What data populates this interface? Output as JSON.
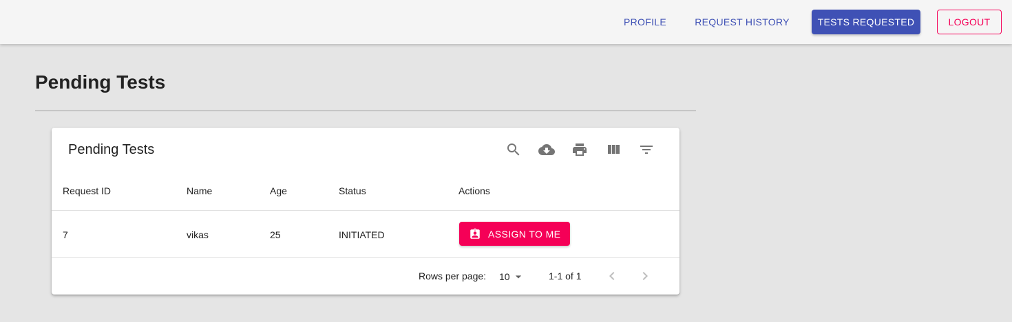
{
  "nav": {
    "profile": "PROFILE",
    "history": "REQUEST HISTORY",
    "tests": "TESTS REQUESTED",
    "logout": "LOGOUT"
  },
  "page": {
    "title": "Pending Tests"
  },
  "table": {
    "title": "Pending Tests",
    "tool_icons": [
      "search-icon",
      "cloud-download-icon",
      "print-icon",
      "view-column-icon",
      "filter-list-icon"
    ],
    "columns": [
      "Request ID",
      "Name",
      "Age",
      "Status",
      "Actions"
    ],
    "rows": [
      {
        "request_id": "7",
        "name": "vikas",
        "age": "25",
        "status": "INITIATED",
        "action_label": "ASSIGN TO ME"
      }
    ],
    "pagination": {
      "rows_label": "Rows per page:",
      "rows_value": "10",
      "range": "1-1 of 1"
    }
  },
  "colors": {
    "primary": "#3f51b5",
    "secondary": "#f50057",
    "appbar": "#f5f5f5",
    "background": "#e5e5e5"
  }
}
